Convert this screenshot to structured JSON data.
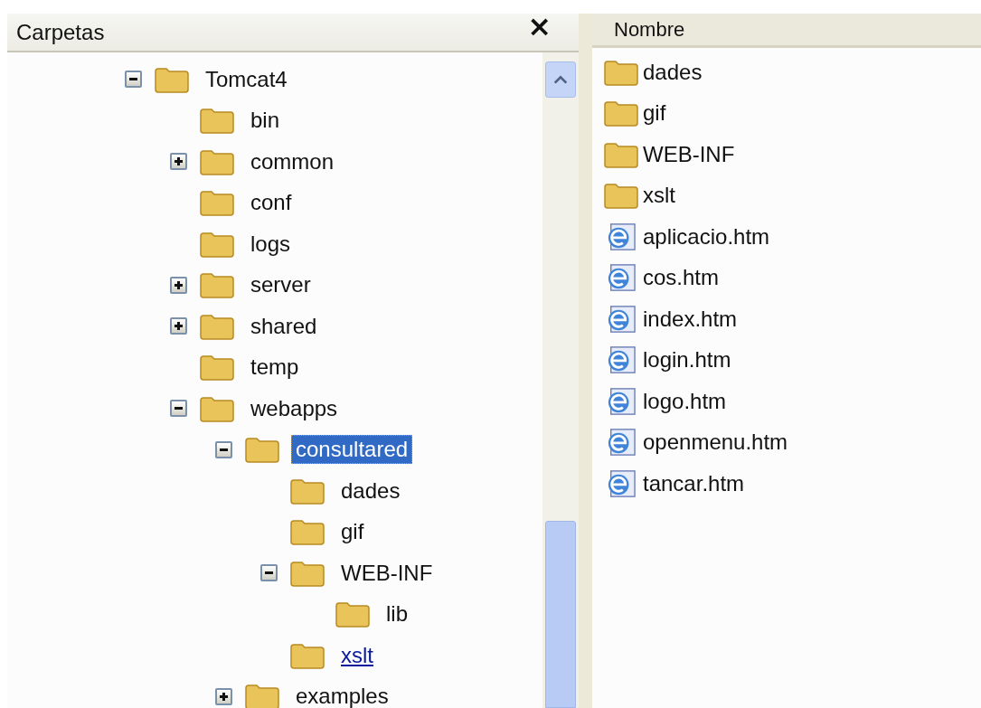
{
  "folders_pane": {
    "title": "Carpetas",
    "close": "×",
    "tree": [
      {
        "label": "Tomcat4",
        "expandable": true,
        "expanded": true,
        "selected": false,
        "hot": false,
        "children": [
          {
            "label": "bin",
            "expandable": false,
            "expanded": false,
            "selected": false,
            "hot": false
          },
          {
            "label": "common",
            "expandable": true,
            "expanded": false,
            "selected": false,
            "hot": false
          },
          {
            "label": "conf",
            "expandable": false,
            "expanded": false,
            "selected": false,
            "hot": false
          },
          {
            "label": "logs",
            "expandable": false,
            "expanded": false,
            "selected": false,
            "hot": false
          },
          {
            "label": "server",
            "expandable": true,
            "expanded": false,
            "selected": false,
            "hot": false
          },
          {
            "label": "shared",
            "expandable": true,
            "expanded": false,
            "selected": false,
            "hot": false
          },
          {
            "label": "temp",
            "expandable": false,
            "expanded": false,
            "selected": false,
            "hot": false
          },
          {
            "label": "webapps",
            "expandable": true,
            "expanded": true,
            "selected": false,
            "hot": false,
            "children": [
              {
                "label": "consultared",
                "expandable": true,
                "expanded": true,
                "selected": true,
                "hot": false,
                "children": [
                  {
                    "label": "dades",
                    "expandable": false,
                    "expanded": false,
                    "selected": false,
                    "hot": false
                  },
                  {
                    "label": "gif",
                    "expandable": false,
                    "expanded": false,
                    "selected": false,
                    "hot": false
                  },
                  {
                    "label": "WEB-INF",
                    "expandable": true,
                    "expanded": true,
                    "selected": false,
                    "hot": false,
                    "children": [
                      {
                        "label": "lib",
                        "expandable": false,
                        "expanded": false,
                        "selected": false,
                        "hot": false
                      }
                    ]
                  },
                  {
                    "label": "xslt",
                    "expandable": false,
                    "expanded": false,
                    "selected": false,
                    "hot": true
                  }
                ]
              },
              {
                "label": "examples",
                "expandable": true,
                "expanded": false,
                "selected": false,
                "hot": false
              }
            ]
          }
        ]
      }
    ]
  },
  "files_pane": {
    "column": "Nombre",
    "items": [
      {
        "name": "dades",
        "kind": "folder"
      },
      {
        "name": "gif",
        "kind": "folder"
      },
      {
        "name": "WEB-INF",
        "kind": "folder"
      },
      {
        "name": "xslt",
        "kind": "folder"
      },
      {
        "name": "aplicacio.htm",
        "kind": "html"
      },
      {
        "name": "cos.htm",
        "kind": "html"
      },
      {
        "name": "index.htm",
        "kind": "html"
      },
      {
        "name": "login.htm",
        "kind": "html"
      },
      {
        "name": "logo.htm",
        "kind": "html"
      },
      {
        "name": "openmenu.htm",
        "kind": "html"
      },
      {
        "name": "tancar.htm",
        "kind": "html"
      }
    ]
  }
}
